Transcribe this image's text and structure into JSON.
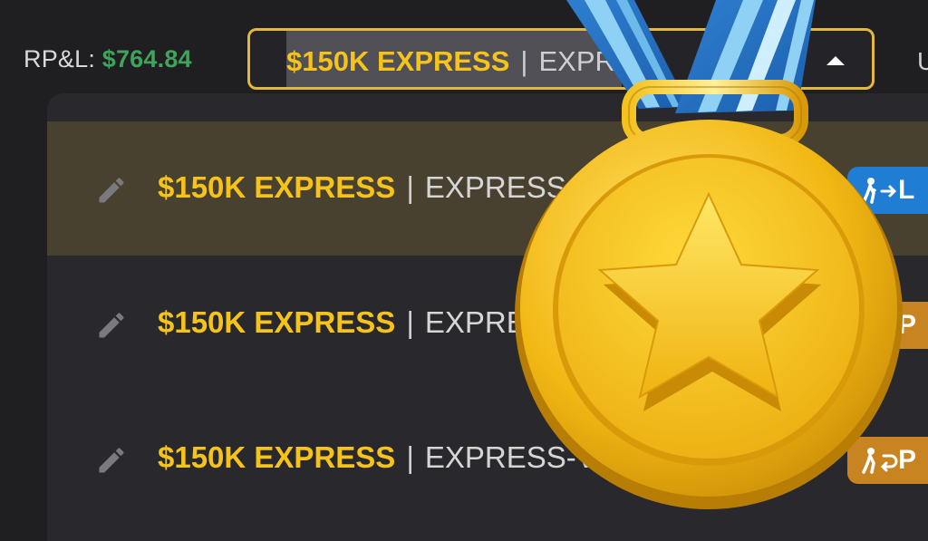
{
  "header": {
    "rpl_label": "RP&L:",
    "rpl_value": "$764.84",
    "selector": {
      "account_name": "$150K EXPRESS",
      "separator": "|",
      "account_type": "EXPR"
    },
    "edge_letter": "U"
  },
  "accounts": [
    {
      "name": "$150K EXPRESS",
      "separator": "|",
      "type": "EXPRESS-V2",
      "badge": "L",
      "badge_icon": "walking-arrow-icon",
      "badge_color": "#1f7ed4",
      "selected": true
    },
    {
      "name": "$150K EXPRESS",
      "separator": "|",
      "type": "EXPRESS",
      "badge": "P",
      "badge_icon": "walking-return-icon",
      "badge_color": "#c98422",
      "selected": false
    },
    {
      "name": "$150K EXPRESS",
      "separator": "|",
      "type": "EXPRESS-V2",
      "badge": "P",
      "badge_icon": "walking-return-icon",
      "badge_color": "#c98422",
      "selected": false
    }
  ],
  "overlay": {
    "icon": "gold-medal-icon"
  },
  "colors": {
    "accent": "#f5c31a",
    "profit": "#3fa35c",
    "selector_border": "#e4b83c"
  }
}
